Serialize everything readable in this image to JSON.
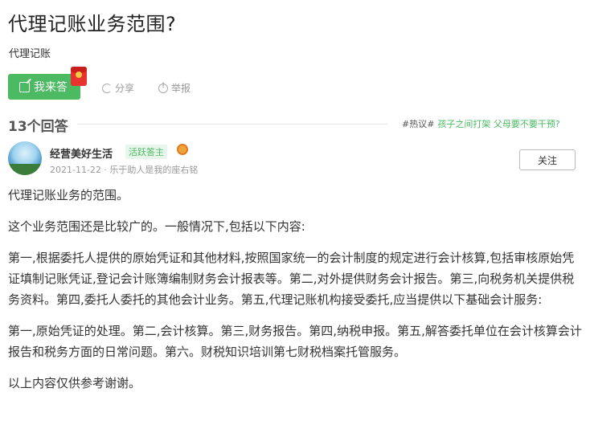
{
  "question": {
    "title": "代理记账业务范围?",
    "tag": "代理记账"
  },
  "actions": {
    "answer_label": "我来答",
    "share_label": "分享",
    "report_label": "举报"
  },
  "answers": {
    "count_label": "13个回答",
    "hot_prefix": "#热议#",
    "hot_link": "孩子之间打架 父母要不要干预?"
  },
  "answer": {
    "author": "经营美好生活",
    "badge": "活跃答主",
    "meta": "2021-11-22 · 乐于助人是我的座右铭",
    "follow_label": "关注",
    "paragraphs": [
      "代理记账业务的范围。",
      "这个业务范围还是比较广的。一般情况下,包括以下内容:",
      "第一,根据委托人提供的原始凭证和其他材料,按照国家统一的会计制度的规定进行会计核算,包括审核原始凭证填制记账凭证,登记会计账簿编制财务会计报表等。第二,对外提供财务会计报告。第三,向税务机关提供税务资料。第四,委托人委托的其他会计业务。第五,代理记账机构接受委托,应当提供以下基础会计服务:",
      "第一,原始凭证的处理。第二,会计核算。第三,财务报告。第四,纳税申报。第五,解答委托单位在会计核算会计报告和税务方面的日常问题。第六。财税知识培训第七财税档案托管服务。",
      "以上内容仅供参考谢谢。"
    ]
  },
  "colors": {
    "accent": "#4cb963",
    "redpacket": "#e8322f"
  }
}
